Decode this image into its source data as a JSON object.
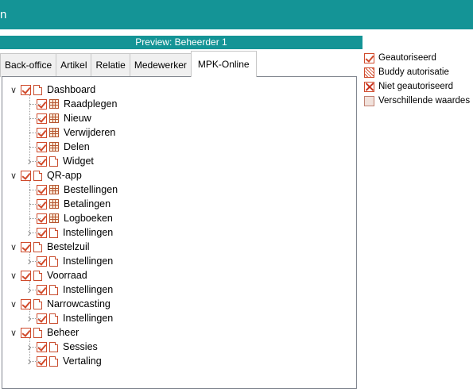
{
  "window": {
    "title_fragment": "n"
  },
  "preview": {
    "title": "Preview: Beheerder 1"
  },
  "tabs": [
    {
      "label": "Back-office",
      "active": false
    },
    {
      "label": "Artikel",
      "active": false
    },
    {
      "label": "Relatie",
      "active": false
    },
    {
      "label": "Medewerker",
      "active": false
    },
    {
      "label": "MPK-Online",
      "active": true
    }
  ],
  "tree": [
    {
      "label": "Dashboard",
      "level": 0,
      "expander": "expanded",
      "icon": "document-icon",
      "checked": true
    },
    {
      "label": "Raadplegen",
      "level": 1,
      "expander": "none",
      "icon": "grid-icon",
      "checked": true
    },
    {
      "label": "Nieuw",
      "level": 1,
      "expander": "none",
      "icon": "grid-icon",
      "checked": true
    },
    {
      "label": "Verwijderen",
      "level": 1,
      "expander": "none",
      "icon": "grid-icon",
      "checked": true
    },
    {
      "label": "Delen",
      "level": 1,
      "expander": "none",
      "icon": "grid-icon",
      "checked": true
    },
    {
      "label": "Widget",
      "level": 1,
      "expander": "collapsed",
      "icon": "document-icon",
      "checked": true
    },
    {
      "label": "QR-app",
      "level": 0,
      "expander": "expanded",
      "icon": "document-icon",
      "checked": true
    },
    {
      "label": "Bestellingen",
      "level": 1,
      "expander": "none",
      "icon": "grid-icon",
      "checked": true
    },
    {
      "label": "Betalingen",
      "level": 1,
      "expander": "none",
      "icon": "grid-icon",
      "checked": true
    },
    {
      "label": "Logboeken",
      "level": 1,
      "expander": "none",
      "icon": "grid-icon",
      "checked": true
    },
    {
      "label": "Instellingen",
      "level": 1,
      "expander": "collapsed",
      "icon": "document-icon",
      "checked": true
    },
    {
      "label": "Bestelzuil",
      "level": 0,
      "expander": "expanded",
      "icon": "document-icon",
      "checked": true
    },
    {
      "label": "Instellingen",
      "level": 1,
      "expander": "collapsed",
      "icon": "document-icon",
      "checked": true
    },
    {
      "label": "Voorraad",
      "level": 0,
      "expander": "expanded",
      "icon": "document-icon",
      "checked": true
    },
    {
      "label": "Instellingen",
      "level": 1,
      "expander": "collapsed",
      "icon": "document-icon",
      "checked": true
    },
    {
      "label": "Narrowcasting",
      "level": 0,
      "expander": "expanded",
      "icon": "document-icon",
      "checked": true
    },
    {
      "label": "Instellingen",
      "level": 1,
      "expander": "collapsed",
      "icon": "document-icon",
      "checked": true
    },
    {
      "label": "Beheer",
      "level": 0,
      "expander": "expanded",
      "icon": "document-icon",
      "checked": true
    },
    {
      "label": "Sessies",
      "level": 1,
      "expander": "collapsed",
      "icon": "document-icon",
      "checked": true
    },
    {
      "label": "Vertaling",
      "level": 1,
      "expander": "collapsed",
      "icon": "document-icon",
      "checked": true
    }
  ],
  "legend": [
    {
      "label": "Geautoriseerd",
      "icon": "authorized-icon"
    },
    {
      "label": "Buddy autorisatie",
      "icon": "buddy-icon"
    },
    {
      "label": "Niet geautoriseerd",
      "icon": "not-authorized-icon"
    },
    {
      "label": "Verschillende waardes",
      "icon": "mixed-values-icon"
    }
  ],
  "colors": {
    "accent": "#149496",
    "checkbox": "#d04a2b"
  }
}
